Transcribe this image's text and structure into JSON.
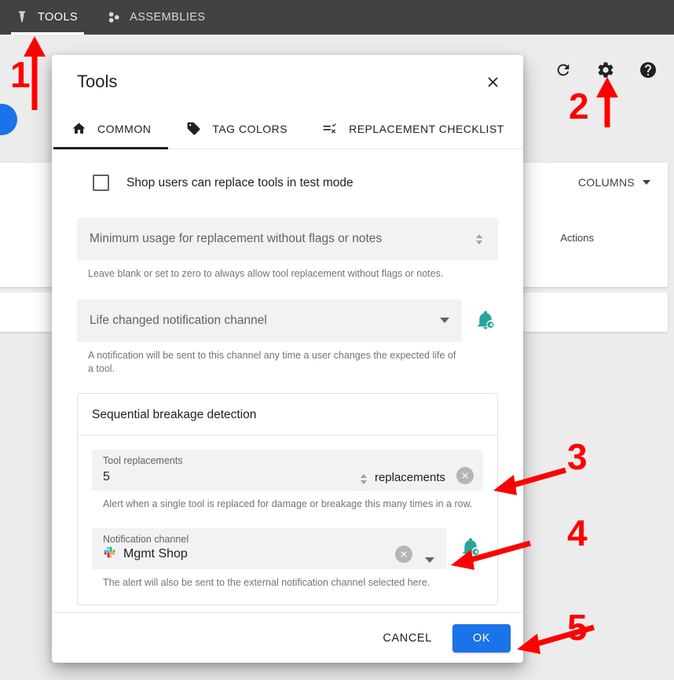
{
  "topnav": {
    "tabs": [
      {
        "label": "TOOLS",
        "icon": "drill-bit-icon",
        "active": true
      },
      {
        "label": "ASSEMBLIES",
        "icon": "assemblies-icon",
        "active": false
      }
    ]
  },
  "background": {
    "icons": [
      {
        "name": "refresh-icon"
      },
      {
        "name": "gear-icon"
      },
      {
        "name": "help-icon"
      }
    ],
    "columns_button": "COLUMNS",
    "table_header_actions": "Actions"
  },
  "dialog": {
    "title": "Tools",
    "close_label": "✕",
    "tabs": [
      {
        "label": "COMMON",
        "icon": "home-icon",
        "active": true
      },
      {
        "label": "TAG COLORS",
        "icon": "tag-icon",
        "active": false
      },
      {
        "label": "REPLACEMENT CHECKLIST",
        "icon": "checklist-icon",
        "active": false
      }
    ],
    "checkbox": {
      "label": "Shop users can replace tools in test mode",
      "checked": false
    },
    "min_usage": {
      "placeholder": "Minimum usage for replacement without flags or notes",
      "value": "",
      "helper": "Leave blank or set to zero to always allow tool replacement without flags or notes."
    },
    "life_channel": {
      "placeholder": "Life changed notification channel",
      "value": "",
      "helper": "A notification will be sent to this channel any time a user changes the expected life of a tool."
    },
    "panel": {
      "title": "Sequential breakage detection",
      "tool_replacements": {
        "label": "Tool replacements",
        "value": "5",
        "suffix": "replacements",
        "helper": "Alert when a single tool is replaced for damage or breakage this many times in a row."
      },
      "notification_channel": {
        "label": "Notification channel",
        "value": "Mgmt Shop",
        "icon": "slack-icon",
        "helper": "The alert will also be sent to the external notification channel selected here."
      }
    },
    "footer": {
      "cancel": "CANCEL",
      "ok": "OK"
    }
  },
  "annotations": {
    "color": "#ff0000",
    "steps": [
      {
        "number": "1",
        "target": "tools-nav-tab"
      },
      {
        "number": "2",
        "target": "gear-icon"
      },
      {
        "number": "3",
        "target": "tool-replacements-clear-button"
      },
      {
        "number": "4",
        "target": "notification-channel-dropdown"
      },
      {
        "number": "5",
        "target": "ok-button"
      }
    ]
  },
  "colors": {
    "topnav_bg": "#424242",
    "page_bg": "#ececec",
    "primary_button": "#1a73e8",
    "bell_icon": "#26a69a",
    "annotation": "#ff0000"
  }
}
